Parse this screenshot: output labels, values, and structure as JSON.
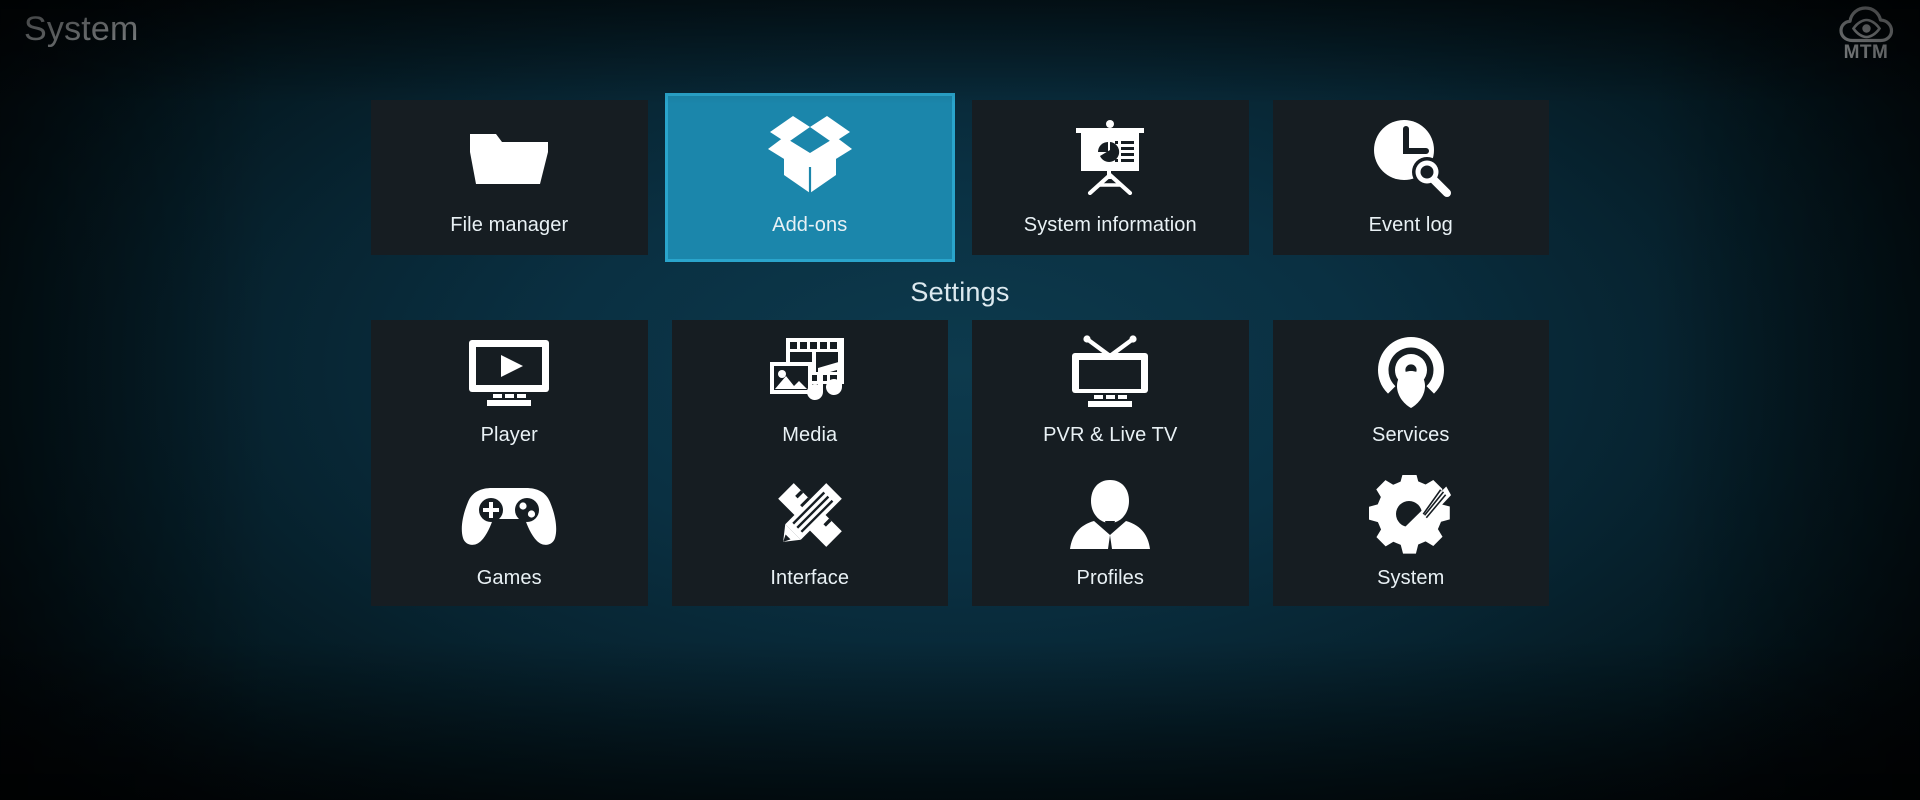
{
  "header": {
    "title": "System",
    "logo": {
      "icon": "cloud-eye-logo",
      "text": "MTM"
    }
  },
  "colors": {
    "tile_background": "#161d22",
    "tile_selected": "#1b86ab",
    "tile_selected_border": "#2aa5cc",
    "text": "#e9f1f5",
    "background_center": "#0d3a4d",
    "background_edge": "#01070a"
  },
  "sections": [
    {
      "id": "top-row",
      "label": "",
      "items": [
        {
          "label": "File manager",
          "icon": "folder-icon",
          "selected": false
        },
        {
          "label": "Add-ons",
          "icon": "open-box-icon",
          "selected": true
        },
        {
          "label": "System information",
          "icon": "presentation-icon",
          "selected": false
        },
        {
          "label": "Event log",
          "icon": "clock-search-icon",
          "selected": false
        }
      ]
    },
    {
      "id": "settings",
      "label": "Settings",
      "items": [
        {
          "label": "Player",
          "icon": "monitor-play-icon",
          "selected": false
        },
        {
          "label": "Media",
          "icon": "media-library-icon",
          "selected": false
        },
        {
          "label": "PVR & Live TV",
          "icon": "tv-antenna-icon",
          "selected": false
        },
        {
          "label": "Services",
          "icon": "broadcast-icon",
          "selected": false
        },
        {
          "label": "Games",
          "icon": "gamepad-icon",
          "selected": false
        },
        {
          "label": "Interface",
          "icon": "pencil-ruler-icon",
          "selected": false
        },
        {
          "label": "Profiles",
          "icon": "person-icon",
          "selected": false
        },
        {
          "label": "System",
          "icon": "gear-wrench-icon",
          "selected": false
        }
      ]
    }
  ]
}
